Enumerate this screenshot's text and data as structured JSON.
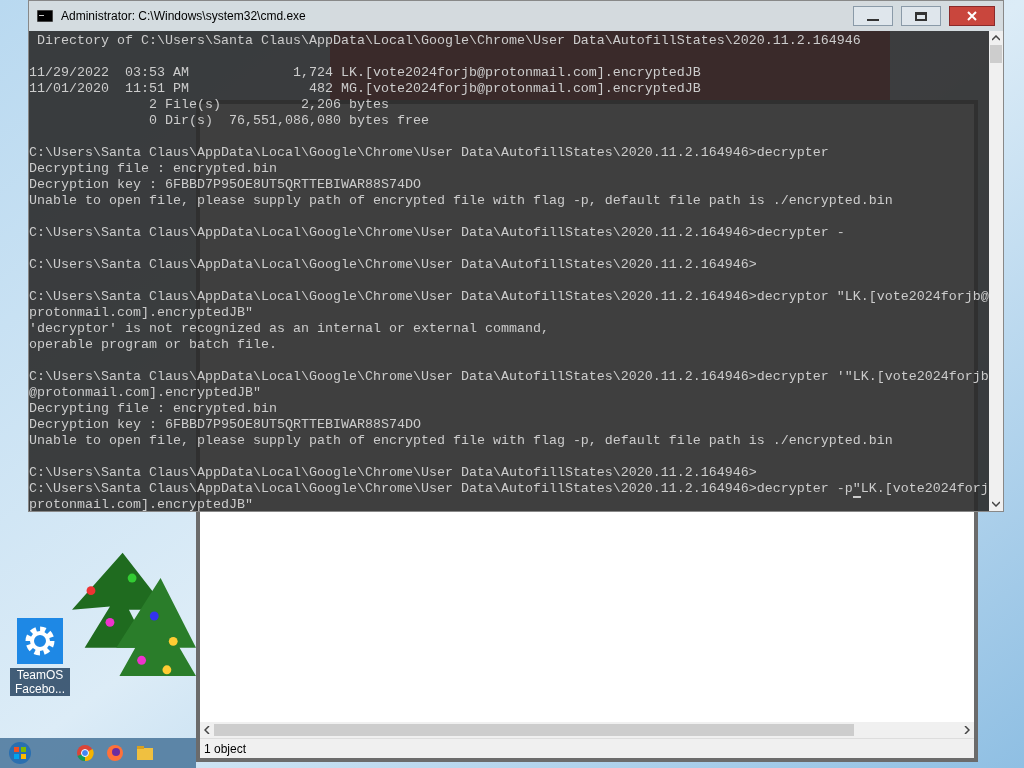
{
  "cmd_window": {
    "title": "Administrator: C:\\Windows\\system32\\cmd.exe",
    "blocks": [
      [
        " Directory of C:\\Users\\Santa Claus\\AppData\\Local\\Google\\Chrome\\User Data\\AutofillStates\\2020.11.2.164946"
      ],
      [
        "11/29/2022  03:53 AM             1,724 LK.[vote2024forjb@protonmail.com].encryptedJB",
        "11/01/2020  11:51 PM               482 MG.[vote2024forjb@protonmail.com].encryptedJB",
        "               2 File(s)          2,206 bytes",
        "               0 Dir(s)  76,551,086,080 bytes free"
      ],
      [
        "C:\\Users\\Santa Claus\\AppData\\Local\\Google\\Chrome\\User Data\\AutofillStates\\2020.11.2.164946>decrypter",
        "Decrypting file : encrypted.bin",
        "Decryption key : 6FBBD7P95OE8UT5QRTTEBIWAR88S74DO",
        "Unable to open file, please supply path of encrypted file with flag -p, default file path is ./encrypted.bin"
      ],
      [
        "C:\\Users\\Santa Claus\\AppData\\Local\\Google\\Chrome\\User Data\\AutofillStates\\2020.11.2.164946>decrypter -"
      ],
      [
        "C:\\Users\\Santa Claus\\AppData\\Local\\Google\\Chrome\\User Data\\AutofillStates\\2020.11.2.164946>"
      ],
      [
        "C:\\Users\\Santa Claus\\AppData\\Local\\Google\\Chrome\\User Data\\AutofillStates\\2020.11.2.164946>decryptor \"LK.[vote2024forjb@",
        "protonmail.com].encryptedJB\"",
        "'decryptor' is not recognized as an internal or external command,",
        "operable program or batch file."
      ],
      [
        "C:\\Users\\Santa Claus\\AppData\\Local\\Google\\Chrome\\User Data\\AutofillStates\\2020.11.2.164946>decrypter '\"LK.[vote2024forjb",
        "@protonmail.com].encryptedJB\"",
        "Decrypting file : encrypted.bin",
        "Decryption key : 6FBBD7P95OE8UT5QRTTEBIWAR88S74DO",
        "Unable to open file, please supply path of encrypted file with flag -p, default file path is ./encrypted.bin"
      ],
      [
        "C:\\Users\\Santa Claus\\AppData\\Local\\Google\\Chrome\\User Data\\AutofillStates\\2020.11.2.164946>",
        {
          "before": "C:\\Users\\Santa Claus\\AppData\\Local\\Google\\Chrome\\User Data\\AutofillStates\\2020.11.2.164946>decrypter -p",
          "at_cursor": "\"",
          "after": "LK.[vote2024forj"
        },
        "protonmail.com].encryptedJB\""
      ]
    ]
  },
  "explorer_window": {
    "status": "1 object"
  },
  "desktop_icons": [
    {
      "label": "TeamOS Facebo..."
    }
  ]
}
